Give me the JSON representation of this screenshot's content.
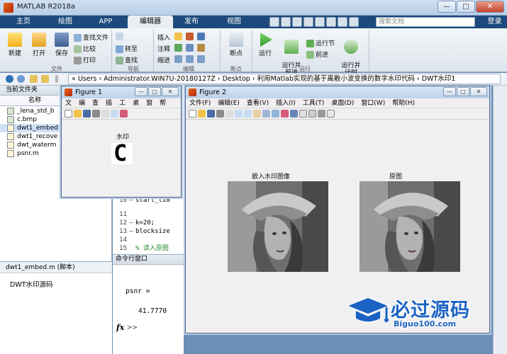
{
  "app": {
    "title": "MATLAB R2018a"
  },
  "window_controls": {
    "minimize": "—",
    "maximize": "□",
    "close": "✕"
  },
  "ribbon_tabs": [
    "主页",
    "绘图",
    "APP",
    "编辑器",
    "发布",
    "视图"
  ],
  "active_tab": "编辑器",
  "search": {
    "placeholder": "搜索文档"
  },
  "login_label": "登录",
  "toolbar": {
    "new": "新建",
    "open": "打开",
    "save": "保存",
    "find_files": "查找文件",
    "compare": "比较",
    "print": "打印",
    "goto": "转至",
    "find": "查找",
    "insert": "插入",
    "comment": "注释",
    "indent": "缩进",
    "breakpoint": "断点",
    "run": "运行",
    "run_advance": "运行并\n前进",
    "run_section": "运行节",
    "advance": "前进",
    "run_time": "运行并\n计时",
    "groups": {
      "file": "文件",
      "nav": "导航",
      "edit": "编辑",
      "breakpoints": "断点",
      "run": "运行"
    }
  },
  "address": {
    "path": "« Users › Administrator.WIN7U-20180127Z › Desktop › 利用Matlab实现的基于离散小波变换的数字水印代码 › DWT水印1"
  },
  "current_folder": {
    "title": "当前文件夹",
    "column": "名称",
    "files": [
      {
        "name": "_lena_std_b",
        "icon": "image-file-icon"
      },
      {
        "name": "c.bmp",
        "icon": "image-file-icon"
      },
      {
        "name": "dwt1_embed",
        "icon": "m-file-icon",
        "selected": true
      },
      {
        "name": "dwt1_recove",
        "icon": "m-file-icon"
      },
      {
        "name": "dwt_waterm",
        "icon": "m-file-icon"
      },
      {
        "name": "psnr.m",
        "icon": "m-file-icon"
      }
    ]
  },
  "details": {
    "title": "dwt1_embed.m  (脚本)",
    "description": "DWT水印源码"
  },
  "editor": {
    "lines": [
      {
        "num": "10",
        "dash": "—",
        "text": "start_tim",
        "kind": "code"
      },
      {
        "num": "11",
        "dash": "",
        "text": "",
        "kind": "code"
      },
      {
        "num": "12",
        "dash": "—",
        "text": "k=20;",
        "kind": "code"
      },
      {
        "num": "13",
        "dash": "—",
        "text": "blocksize",
        "kind": "code"
      },
      {
        "num": "14",
        "dash": "",
        "text": "",
        "kind": "code"
      },
      {
        "num": "15",
        "dash": "",
        "text": "% 读入原图",
        "kind": "comment"
      }
    ]
  },
  "command_window": {
    "title": "命令行窗口",
    "var_label": "psnr =",
    "value": "41.7770",
    "fx": "fx",
    "prompt": ">>"
  },
  "figure1": {
    "title": "Figure 1",
    "menu": [
      "文",
      "编",
      "查",
      "插",
      "工",
      "桌",
      "窗",
      "帮"
    ],
    "axis_title": "水印",
    "watermark_char": "C"
  },
  "figure2": {
    "title": "Figure 2",
    "menu": [
      "文件(F)",
      "编辑(E)",
      "查看(V)",
      "插入(I)",
      "工具(T)",
      "桌面(D)",
      "窗口(W)",
      "帮助(H)"
    ],
    "left_title": "嵌入水印图像",
    "right_title": "原图"
  },
  "logo": {
    "name": "必过源码",
    "url": "Biguo100.com"
  }
}
